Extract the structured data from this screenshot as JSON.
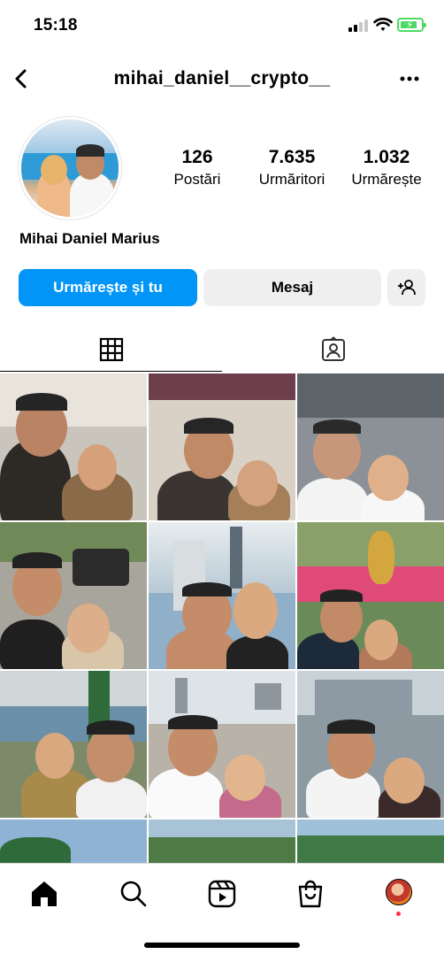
{
  "status_bar": {
    "time": "15:18",
    "signal_icon": "cellular-signal-icon",
    "wifi_icon": "wifi-icon",
    "battery_icon": "battery-charging-icon"
  },
  "header": {
    "username": "mihai_daniel__crypto__",
    "back_icon": "chevron-left-icon",
    "more_icon": "more-horizontal-icon"
  },
  "profile": {
    "display_name": "Mihai Daniel Marius",
    "stats": [
      {
        "value": "126",
        "label": "Postări"
      },
      {
        "value": "7.635",
        "label": "Urmăritori"
      },
      {
        "value": "1.032",
        "label": "Urmărește"
      }
    ]
  },
  "actions": {
    "follow_label": "Urmărește și tu",
    "message_label": "Mesaj",
    "suggest_icon": "add-person-icon"
  },
  "tabs": [
    {
      "icon": "grid-icon",
      "active": true
    },
    {
      "icon": "tagged-person-icon",
      "active": false
    }
  ],
  "colors": {
    "accent": "#0095f6",
    "secondary_button": "#efefef",
    "notification_dot": "#ff3040",
    "battery": "#4cd964"
  },
  "bottom_nav": [
    {
      "icon": "home-icon"
    },
    {
      "icon": "search-icon"
    },
    {
      "icon": "reels-icon"
    },
    {
      "icon": "shop-bag-icon"
    },
    {
      "icon": "profile-avatar-icon"
    }
  ]
}
